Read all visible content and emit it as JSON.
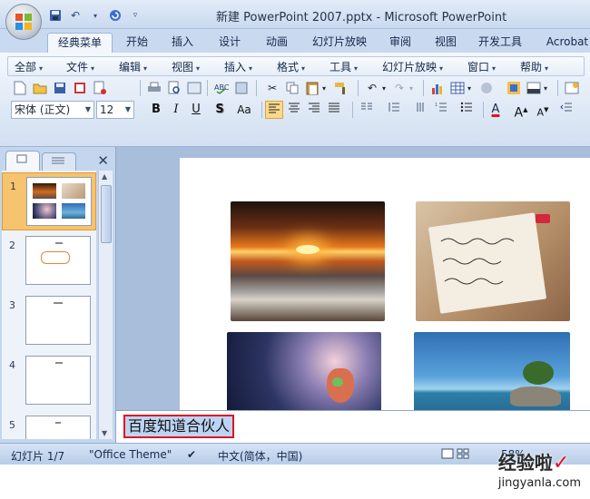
{
  "window": {
    "title": "新建 PowerPoint 2007.pptx - Microsoft PowerPoint"
  },
  "ribbon_tabs": [
    "经典菜单",
    "开始",
    "插入",
    "设计",
    "动画",
    "幻灯片放映",
    "审阅",
    "视图",
    "开发工具",
    "Acrobat"
  ],
  "active_tab": "经典菜单",
  "menus": [
    "全部",
    "文件",
    "编辑",
    "视图",
    "插入",
    "格式",
    "工具",
    "幻灯片放映",
    "窗口",
    "帮助"
  ],
  "font": {
    "name": "宋体 (正文)",
    "size": "12"
  },
  "format_buttons": {
    "bold": "B",
    "italic": "I",
    "underline": "U",
    "shadow": "S",
    "case": "Aa"
  },
  "slides": {
    "count": 7,
    "thumb_numbers": [
      "1",
      "2",
      "3",
      "4",
      "5"
    ],
    "selected": "1"
  },
  "notes": {
    "text": "百度知道合伙人"
  },
  "status": {
    "slide_info": "幻灯片 1/7",
    "theme": "\"Office Theme\"",
    "language": "中文(简体，中国)",
    "zoom": "58%"
  },
  "watermark": {
    "brand": "经验啦",
    "url": "jingyanla.com"
  },
  "colors": {
    "accent_red": "#e0141e",
    "selected_thumb": "#f6c36f",
    "ribbon_blue": "#c9d9ef"
  }
}
